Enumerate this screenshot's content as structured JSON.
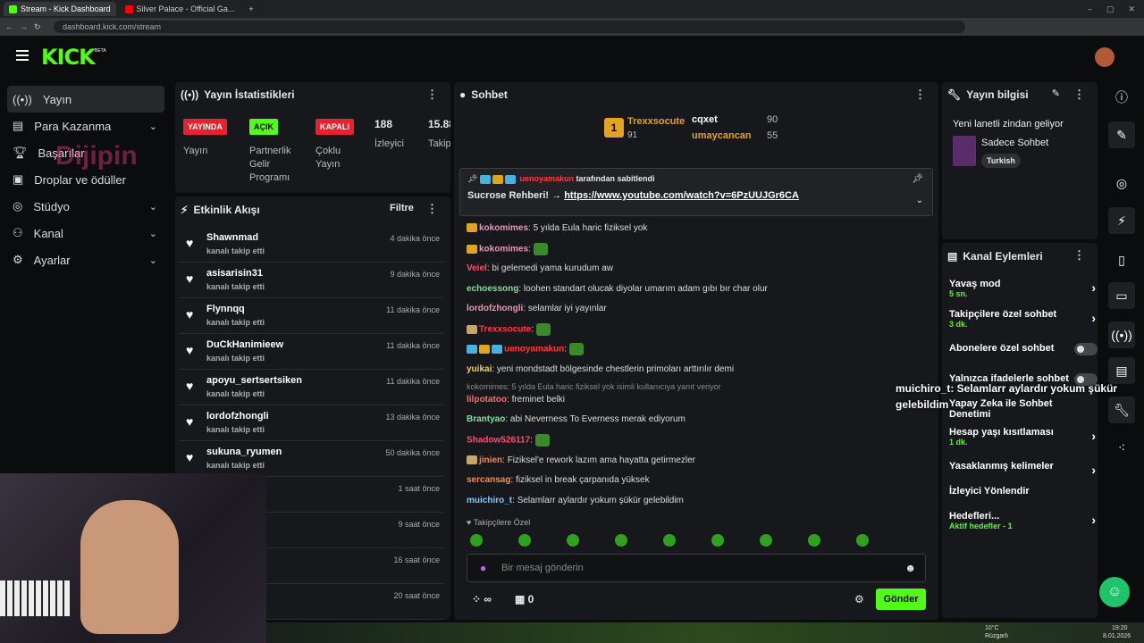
{
  "browser": {
    "tabs": [
      {
        "label": "Stream - Kick Dashboard"
      },
      {
        "label": "Silver Palace - Official Ga..."
      }
    ],
    "url": "dashboard.kick.com/stream"
  },
  "brand": {
    "logo": "KICK",
    "beta": "BETA"
  },
  "sidebar": {
    "items": [
      {
        "label": "Yayın",
        "icon": "broadcast-icon"
      },
      {
        "label": "Para Kazanma",
        "icon": "money-icon"
      },
      {
        "label": "Başarılar",
        "icon": "trophy-icon"
      },
      {
        "label": "Droplar ve ödüller",
        "icon": "gift-icon"
      },
      {
        "label": "Stüdyo",
        "icon": "studio-icon"
      },
      {
        "label": "Kanal",
        "icon": "channel-icon"
      },
      {
        "label": "Ayarlar",
        "icon": "gear-icon"
      }
    ]
  },
  "watermark": "Dijipin",
  "stats": {
    "title": "Yayın İstatistikleri",
    "badges": [
      {
        "label": "YAYINDA",
        "desc": "Yayın",
        "color": "#e8212c"
      },
      {
        "label": "AÇIK",
        "desc": "Partnerlik Gelir Programı",
        "color": "#53fc18"
      },
      {
        "label": "KAPALI",
        "desc": "Çoklu Yayın",
        "color": "#e8212c"
      }
    ],
    "viewers": {
      "value": "188",
      "label": "İzleyici"
    },
    "followers": {
      "value": "15.88",
      "label": "Takip"
    }
  },
  "feed": {
    "title": "Etkinlik Akışı",
    "filter": "Filtre",
    "rows": [
      {
        "name": "Shawnmad",
        "sub": "kanalı takip etti",
        "time": "4 dakika önce"
      },
      {
        "name": "asisarisin31",
        "sub": "kanalı takip etti",
        "time": "9 dakika önce"
      },
      {
        "name": "Flynnqq",
        "sub": "kanalı takip etti",
        "time": "11 dakika önce"
      },
      {
        "name": "DuCkHanimieew",
        "sub": "kanalı takip etti",
        "time": "11 dakika önce"
      },
      {
        "name": "apoyu_sertsertsiken",
        "sub": "kanalı takip etti",
        "time": "11 dakika önce"
      },
      {
        "name": "lordofzhongli",
        "sub": "kanalı takip etti",
        "time": "13 dakika önce"
      },
      {
        "name": "sukuna_ryumen",
        "sub": "kanalı takip etti",
        "time": "50 dakika önce"
      },
      {
        "name": "",
        "sub": "",
        "time": "1 saat önce"
      },
      {
        "name": "",
        "sub": "",
        "time": "9 saat önce"
      },
      {
        "name": "",
        "sub": "",
        "time": "16 saat önce"
      },
      {
        "name": "",
        "sub": "",
        "time": "20 saat önce"
      }
    ]
  },
  "chat": {
    "title": "Sohbet",
    "leaders": [
      {
        "name": "Trexxsocute",
        "count": "91",
        "rank": "1"
      },
      {
        "name": "cqxet",
        "count": "90"
      },
      {
        "name": "umaycancan",
        "count": "55"
      }
    ],
    "pinned": {
      "by": "uenoyamakun",
      "suffix": "tarafından sabitlendi",
      "text": "Sucrose Rehberi! →",
      "link": "https://www.youtube.com/watch?v=6PzUUJGr6CA"
    },
    "messages": [
      {
        "user": "kokomimes",
        "color": "#e39ab0",
        "text": "5 yılda Eula haric fiziksel yok"
      },
      {
        "user": "kokomimes",
        "color": "#e39ab0",
        "text": ""
      },
      {
        "user": "Veiel",
        "color": "#ff4d6d",
        "text": "bi gelemedi yama kurudum aw"
      },
      {
        "user": "echoessong",
        "color": "#7ee0a0",
        "text": "loohen standart olucak diyolar umarım adam gıbı bır char olur"
      },
      {
        "user": "lordofzhongli",
        "color": "#e39ab0",
        "text": "selamlar iyi yayınlar"
      },
      {
        "user": "Trexxsocute",
        "color": "#ff3b3b",
        "text": ""
      },
      {
        "user": "uenoyamakun",
        "color": "#ff3b3b",
        "text": ""
      },
      {
        "user": "yuikai",
        "color": "#e8d060",
        "text": "yeni mondstadt bölgesinde chestlerin primoları arttırılır demi"
      },
      {
        "reply": "kokomimes: 5 yılda Eula haric fiziksel yok isimli kullanıcıya yanıt veriyor",
        "user": "lilpotatoo",
        "color": "#ff6a6a",
        "text": "freminet belki"
      },
      {
        "user": "Brantyao",
        "color": "#7ee0a0",
        "text": "abi Neverness To Everness merak ediyorum"
      },
      {
        "user": "Shadow526117",
        "color": "#ff4d6d",
        "text": ""
      },
      {
        "user": "jinien",
        "color": "#ff8a3d",
        "text": "Fiziksel'e rework lazım ama hayatta getirmezler"
      },
      {
        "user": "sercansag",
        "color": "#ff8a3d",
        "text": "fiziksel in break çarpanıda yüksek"
      },
      {
        "user": "muichiro_t",
        "color": "#7ec8ff",
        "text": "Selamlarr aylardır yokum şükür gelebildim"
      }
    ],
    "followers_only": "Takipçilere Özel",
    "placeholder": "Bir mesaj gönderin",
    "points": "∞",
    "gifts": "0",
    "send": "Gönder"
  },
  "stream_info": {
    "title": "Yayın bilgisi",
    "stream_title": "Yeni lanetli zindan geliyor",
    "category": "Sadece Sohbet",
    "language": "Turkish"
  },
  "actions": {
    "title": "Kanal Eylemleri",
    "rows": [
      {
        "label": "Yavaş mod",
        "sub": "5 sn."
      },
      {
        "label": "Takipçilere özel sohbet",
        "sub": "3 dk."
      },
      {
        "label": "Abonelere özel sohbet",
        "sub": ""
      },
      {
        "label": "Yalnızca ifadelerle sohbet",
        "sub": ""
      },
      {
        "label": "Yapay Zeka ile Sohbet Denetimi",
        "sub": ""
      },
      {
        "label": "Hesap yaşı kısıtlaması",
        "sub": "1 dk."
      },
      {
        "label": "Yasaklanmış kelimeler",
        "sub": ""
      },
      {
        "label": "İzleyici Yönlendir",
        "sub": ""
      },
      {
        "label": "Hedefleri...",
        "sub": "Aktif hedefler - 1"
      }
    ]
  },
  "overlay_msg": {
    "user": "muichiro_t",
    "text": ": Selamlarr aylardır yokum şükür gelebildim"
  },
  "taskbar": {
    "weather": "10°C",
    "weather_desc": "Rüzgarlı",
    "time": "19:20",
    "date": "8.01.2026"
  }
}
